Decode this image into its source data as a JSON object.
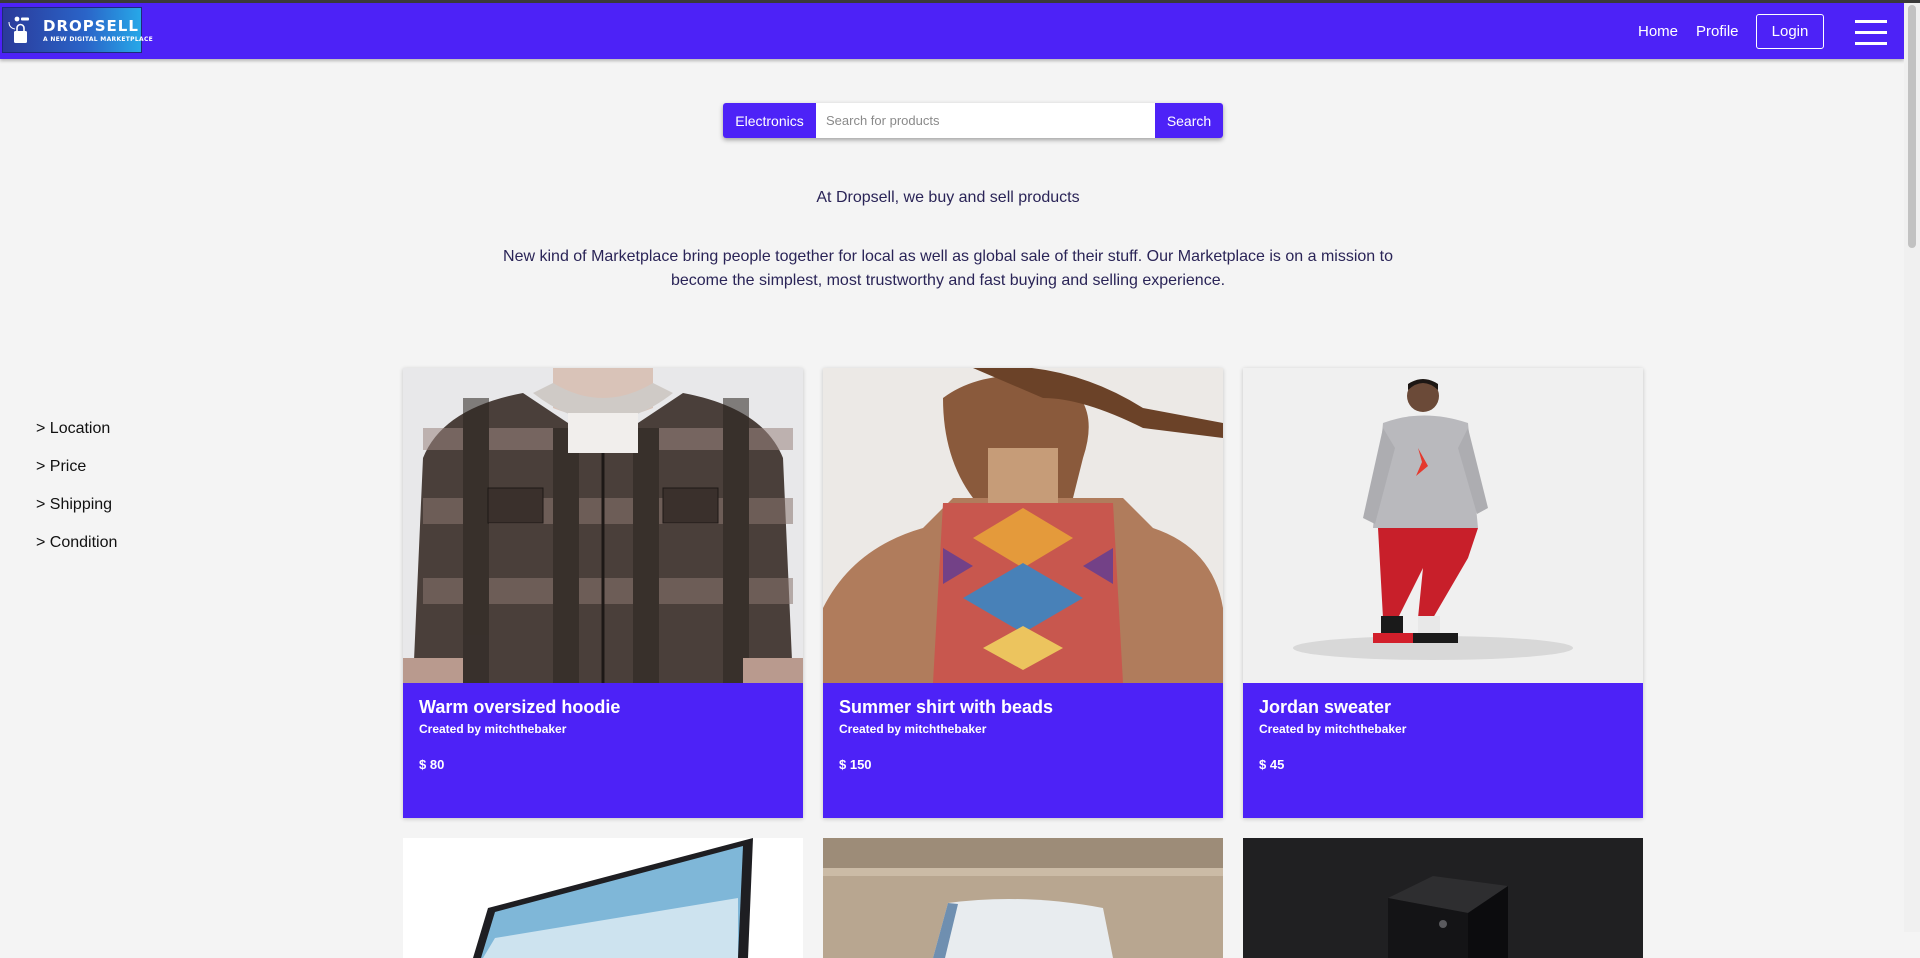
{
  "brand": {
    "name": "DROPSELL",
    "tagline": "A NEW DIGITAL MARKETPLACE",
    "color": "#4d22f7"
  },
  "nav": {
    "home": "Home",
    "profile": "Profile",
    "login": "Login",
    "menu_icon": "hamburger-menu-icon"
  },
  "search": {
    "category": "Electronics",
    "placeholder": "Search for products",
    "value": "",
    "button": "Search"
  },
  "intro": {
    "headline": "At Dropsell, we buy and sell products",
    "mission": "New kind of Marketplace bring people together for local as well as global sale of their stuff. Our Marketplace is on a mission to become the simplest, most trustworthy and fast buying and selling experience."
  },
  "filters": [
    "> Location",
    "> Price",
    "> Shipping",
    "> Condition"
  ],
  "products": [
    {
      "title": "Warm oversized hoodie",
      "author": "Created by mitchthebaker",
      "price": "$ 80"
    },
    {
      "title": "Summer shirt with beads",
      "author": "Created by mitchthebaker",
      "price": "$ 150"
    },
    {
      "title": "Jordan sweater",
      "author": "Created by mitchthebaker",
      "price": "$ 45"
    }
  ]
}
